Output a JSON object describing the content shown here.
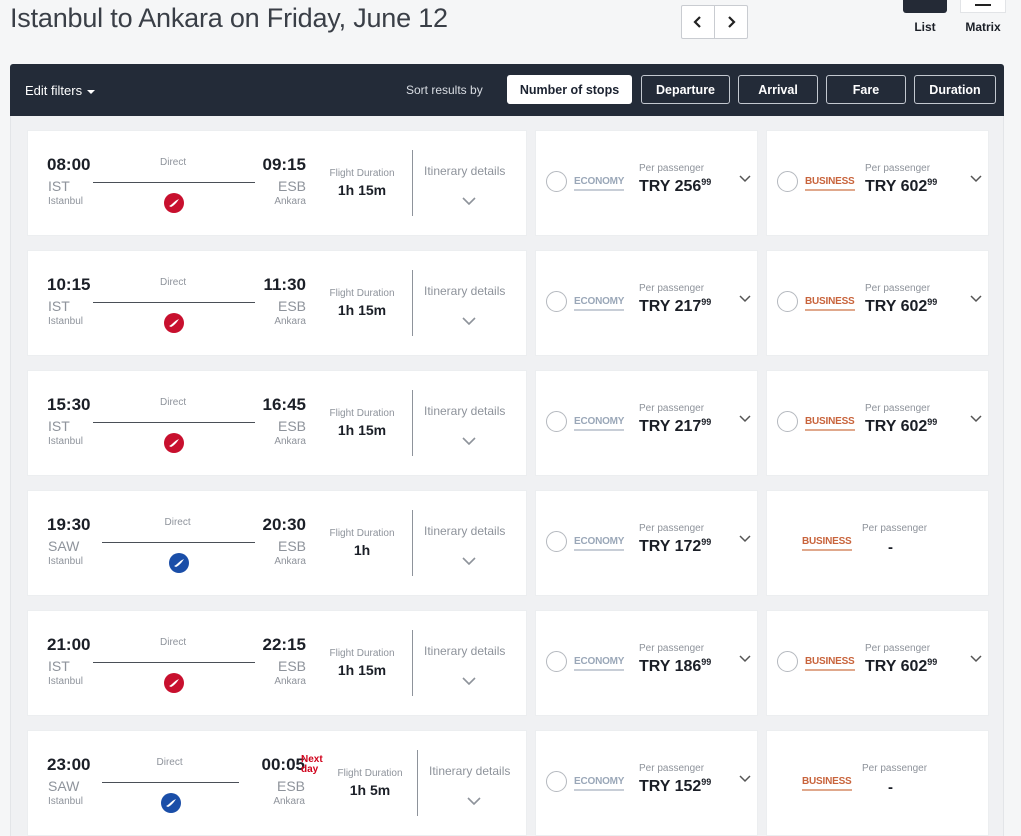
{
  "page_title": "Istanbul to Ankara on Friday, June 12",
  "view_toggle": {
    "list_label": "List",
    "matrix_label": "Matrix"
  },
  "filter_bar": {
    "edit_filters": "Edit filters",
    "sort_label": "Sort results by",
    "sort_options": [
      "Number of stops",
      "Departure",
      "Arrival",
      "Fare",
      "Duration"
    ],
    "active_sort": "Number of stops"
  },
  "labels": {
    "flight_duration": "Flight Duration",
    "itinerary_details": "Itinerary details",
    "per_passenger": "Per passenger",
    "economy": "ECONOMY",
    "business": "BUSINESS",
    "currency": "TRY"
  },
  "colors": {
    "header_bg": "#232b38",
    "thy_red": "#c8102e",
    "ajet_blue": "#1a4ea8",
    "business_accent": "#c8633b",
    "next_day": "#d0021b"
  },
  "flights": [
    {
      "dep_time": "08:00",
      "dep_code": "IST",
      "dep_city": "Istanbul",
      "stops": "Direct",
      "arr_time": "09:15",
      "arr_code": "ESB",
      "arr_city": "Ankara",
      "next_day": "",
      "duration": "1h 15m",
      "airline": "thy-icon",
      "economy_main": "256",
      "economy_cents": "99",
      "business_main": "602",
      "business_cents": "99",
      "business_available": true
    },
    {
      "dep_time": "10:15",
      "dep_code": "IST",
      "dep_city": "Istanbul",
      "stops": "Direct",
      "arr_time": "11:30",
      "arr_code": "ESB",
      "arr_city": "Ankara",
      "next_day": "",
      "duration": "1h 15m",
      "airline": "thy-icon",
      "economy_main": "217",
      "economy_cents": "99",
      "business_main": "602",
      "business_cents": "99",
      "business_available": true
    },
    {
      "dep_time": "15:30",
      "dep_code": "IST",
      "dep_city": "Istanbul",
      "stops": "Direct",
      "arr_time": "16:45",
      "arr_code": "ESB",
      "arr_city": "Ankara",
      "next_day": "",
      "duration": "1h 15m",
      "airline": "thy-icon",
      "economy_main": "217",
      "economy_cents": "99",
      "business_main": "602",
      "business_cents": "99",
      "business_available": true
    },
    {
      "dep_time": "19:30",
      "dep_code": "SAW",
      "dep_city": "Istanbul",
      "stops": "Direct",
      "arr_time": "20:30",
      "arr_code": "ESB",
      "arr_city": "Ankara",
      "next_day": "",
      "duration": "1h",
      "airline": "ajet-icon",
      "economy_main": "172",
      "economy_cents": "99",
      "business_main": "",
      "business_cents": "",
      "business_unavailable": "-",
      "business_available": false
    },
    {
      "dep_time": "21:00",
      "dep_code": "IST",
      "dep_city": "Istanbul",
      "stops": "Direct",
      "arr_time": "22:15",
      "arr_code": "ESB",
      "arr_city": "Ankara",
      "next_day": "",
      "duration": "1h 15m",
      "airline": "thy-icon",
      "economy_main": "186",
      "economy_cents": "99",
      "business_main": "602",
      "business_cents": "99",
      "business_available": true
    },
    {
      "dep_time": "23:00",
      "dep_code": "SAW",
      "dep_city": "Istanbul",
      "stops": "Direct",
      "arr_time": "00:05",
      "arr_code": "ESB",
      "arr_city": "Ankara",
      "next_day": "Next day",
      "duration": "1h 5m",
      "airline": "ajet-icon",
      "economy_main": "152",
      "economy_cents": "99",
      "business_main": "",
      "business_cents": "",
      "business_unavailable": "-",
      "business_available": false
    }
  ]
}
